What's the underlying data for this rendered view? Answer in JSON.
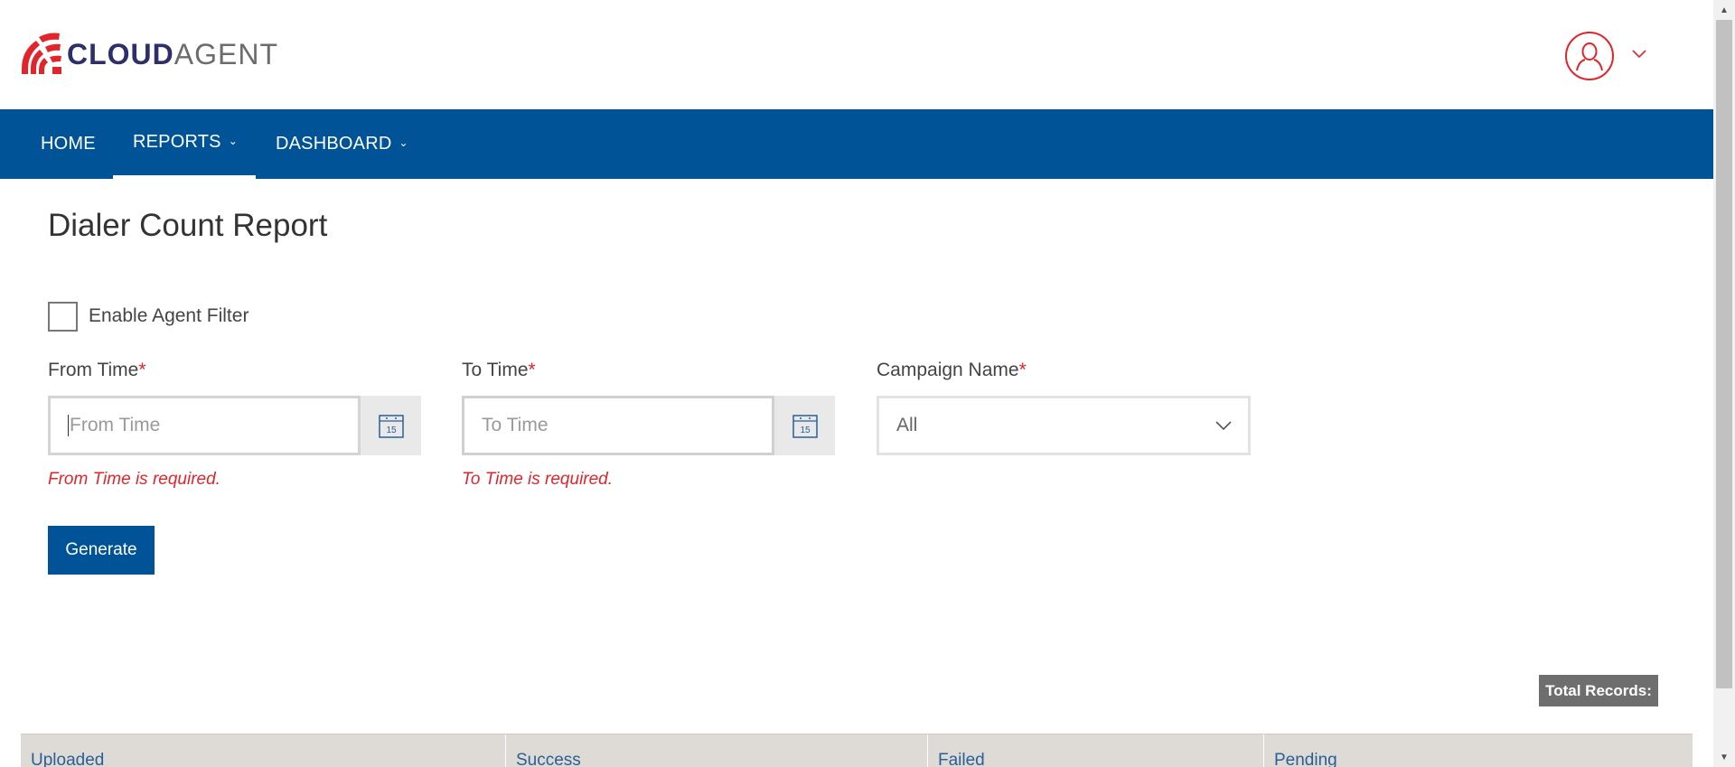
{
  "brand": {
    "name_part1": "CLOUD",
    "name_part2": "AGENT",
    "accent_color": "#e0262c",
    "primary_color": "#005396"
  },
  "header": {
    "avatar_icon": "user-avatar-icon",
    "dropdown_icon": "chevron-down-icon"
  },
  "nav": {
    "home": "HOME",
    "reports": "REPORTS",
    "dashboard": "DASHBOARD",
    "active": "REPORTS"
  },
  "page": {
    "title": "Dialer Count Report"
  },
  "filters": {
    "agent_filter_label": "Enable Agent Filter",
    "agent_filter_checked": false,
    "from_time": {
      "label": "From Time",
      "required_mark": "*",
      "placeholder": "From Time",
      "value": "",
      "error": "From Time is required.",
      "calendar_day": "15"
    },
    "to_time": {
      "label": "To Time",
      "required_mark": "*",
      "placeholder": "To Time",
      "value": "",
      "error": "To Time is required.",
      "calendar_day": "15"
    },
    "campaign": {
      "label": "Campaign Name",
      "required_mark": "*",
      "selected": "All"
    }
  },
  "actions": {
    "generate_label": "Generate"
  },
  "results": {
    "total_records_label": "Total Records:",
    "columns": [
      "Uploaded",
      "Success",
      "Failed",
      "Pending"
    ]
  }
}
